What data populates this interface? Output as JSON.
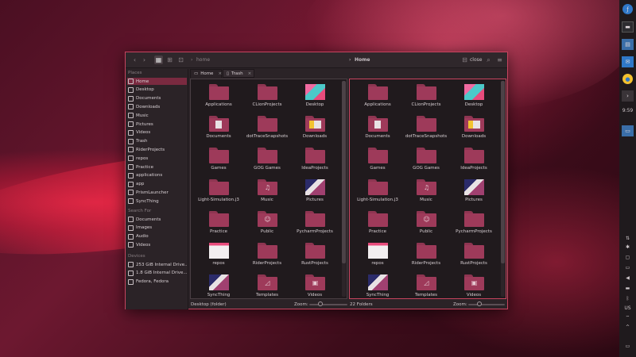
{
  "toolbar": {
    "left_breadcrumb": "home",
    "right_breadcrumb": "Home",
    "close_label": "close"
  },
  "sidebar": {
    "sections": {
      "places": "Places",
      "search": "Search For",
      "devices": "Devices"
    },
    "places": [
      "Home",
      "Desktop",
      "Documents",
      "Downloads",
      "Music",
      "Pictures",
      "Videos",
      "Trash",
      "RiderProjects",
      "repos",
      "Practice",
      "applications",
      "app",
      "PrismLauncher",
      "SyncThing"
    ],
    "search": [
      "Documents",
      "Images",
      "Audio",
      "Videos"
    ],
    "devices": [
      "253 GiB Internal Drive...",
      "1.8 GiB Internal Drive...",
      "Fedora, Fedora"
    ]
  },
  "tabs": [
    {
      "label": "Home"
    },
    {
      "label": "Trash"
    }
  ],
  "left_pane": {
    "items": [
      {
        "label": "Applications",
        "kind": "folder",
        "emblem": ""
      },
      {
        "label": "CLionProjects",
        "kind": "folder",
        "emblem": ""
      },
      {
        "label": "Desktop",
        "kind": "desktop",
        "emblem": ""
      },
      {
        "label": "Documents",
        "kind": "folder",
        "emblem": "doc"
      },
      {
        "label": "dotTraceSnapshots",
        "kind": "folder",
        "emblem": ""
      },
      {
        "label": "Downloads",
        "kind": "folder",
        "emblem": "img"
      },
      {
        "label": "Games",
        "kind": "folder",
        "emblem": ""
      },
      {
        "label": "GOG Games",
        "kind": "folder",
        "emblem": ""
      },
      {
        "label": "IdeaProjects",
        "kind": "folder",
        "emblem": ""
      },
      {
        "label": "Light-Simulation.j3",
        "kind": "folder",
        "emblem": ""
      },
      {
        "label": "Music",
        "kind": "folder",
        "emblem": "♫"
      },
      {
        "label": "Pictures",
        "kind": "pictures",
        "emblem": ""
      },
      {
        "label": "Practice",
        "kind": "folder",
        "emblem": ""
      },
      {
        "label": "Public",
        "kind": "folder",
        "emblem": "☺"
      },
      {
        "label": "PycharmProjects",
        "kind": "folder",
        "emblem": ""
      },
      {
        "label": "repos",
        "kind": "white",
        "emblem": ""
      },
      {
        "label": "RiderProjects",
        "kind": "folder",
        "emblem": ""
      },
      {
        "label": "RustProjects",
        "kind": "folder",
        "emblem": ""
      },
      {
        "label": "SyncThing",
        "kind": "pictures",
        "emblem": ""
      },
      {
        "label": "Templates",
        "kind": "folder",
        "emblem": "◿"
      },
      {
        "label": "Videos",
        "kind": "folder",
        "emblem": "▣"
      }
    ],
    "status_text": "Desktop (folder)",
    "zoom_label": "Zoom:",
    "zoom_level": 0.3
  },
  "right_pane": {
    "items": [
      {
        "label": "Applications",
        "kind": "folder",
        "emblem": ""
      },
      {
        "label": "CLionProjects",
        "kind": "folder",
        "emblem": ""
      },
      {
        "label": "Desktop",
        "kind": "desktop",
        "emblem": ""
      },
      {
        "label": "Documents",
        "kind": "folder",
        "emblem": "doc"
      },
      {
        "label": "dotTraceSnapshots",
        "kind": "folder",
        "emblem": ""
      },
      {
        "label": "Downloads",
        "kind": "folder",
        "emblem": "img"
      },
      {
        "label": "Games",
        "kind": "folder",
        "emblem": ""
      },
      {
        "label": "GOG Games",
        "kind": "folder",
        "emblem": ""
      },
      {
        "label": "IdeaProjects",
        "kind": "folder",
        "emblem": ""
      },
      {
        "label": "Light-Simulation.j3",
        "kind": "folder",
        "emblem": ""
      },
      {
        "label": "Music",
        "kind": "folder",
        "emblem": "♫"
      },
      {
        "label": "Pictures",
        "kind": "pictures",
        "emblem": ""
      },
      {
        "label": "Practice",
        "kind": "folder",
        "emblem": ""
      },
      {
        "label": "Public",
        "kind": "folder",
        "emblem": "☺"
      },
      {
        "label": "PycharmProjects",
        "kind": "folder",
        "emblem": ""
      },
      {
        "label": "repos",
        "kind": "white",
        "emblem": ""
      },
      {
        "label": "RiderProjects",
        "kind": "folder",
        "emblem": ""
      },
      {
        "label": "RustProjects",
        "kind": "folder",
        "emblem": ""
      },
      {
        "label": "SyncThing",
        "kind": "pictures",
        "emblem": ""
      },
      {
        "label": "Templates",
        "kind": "folder",
        "emblem": "◿"
      },
      {
        "label": "Videos",
        "kind": "folder",
        "emblem": "▣"
      }
    ],
    "status_text": "22 Folders",
    "zoom_label": "Zoom:",
    "zoom_level": 0.3
  },
  "panel": {
    "clock": "9:59",
    "clock_bottom_time": "US",
    "colors": {
      "accent": "#c8445f",
      "folder": "#9e3a5a",
      "selection": "#7a2a40"
    }
  }
}
